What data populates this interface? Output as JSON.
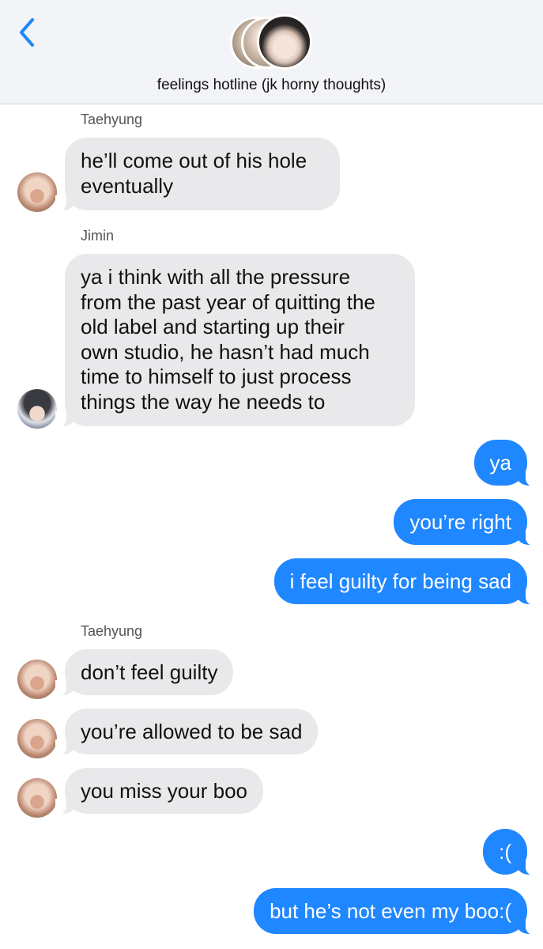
{
  "header": {
    "title": "feelings hotline (jk horny thoughts)",
    "back_icon": "chevron-left-icon",
    "avatars": [
      "group-avatar-1",
      "group-avatar-2",
      "group-avatar-3"
    ]
  },
  "colors": {
    "outgoing_bubble": "#1f87ff",
    "incoming_bubble": "#e9e9eb",
    "header_bg": "#f2f4f7",
    "back_icon": "#1f87ff"
  },
  "messages": [
    {
      "sender": "Taehyung",
      "lines": [
        "he’ll come out of his hole",
        "eventually"
      ]
    },
    {
      "sender": "Jimin",
      "lines": [
        "ya i think with all the pressure",
        "from the past year of quitting the",
        "old label and starting up their",
        "own studio, he hasn’t had much",
        "time to himself to just process",
        "things the way he needs to"
      ]
    },
    {
      "out": "ya"
    },
    {
      "out": "you’re right"
    },
    {
      "out": "i feel guilty for being sad"
    },
    {
      "sender": "Taehyung",
      "lines": [
        "don’t feel guilty"
      ]
    },
    {
      "lines": [
        "you’re allowed to be sad"
      ]
    },
    {
      "lines": [
        "you miss your boo"
      ]
    },
    {
      "out": ":("
    },
    {
      "out": "but he’s not even my boo:("
    }
  ]
}
